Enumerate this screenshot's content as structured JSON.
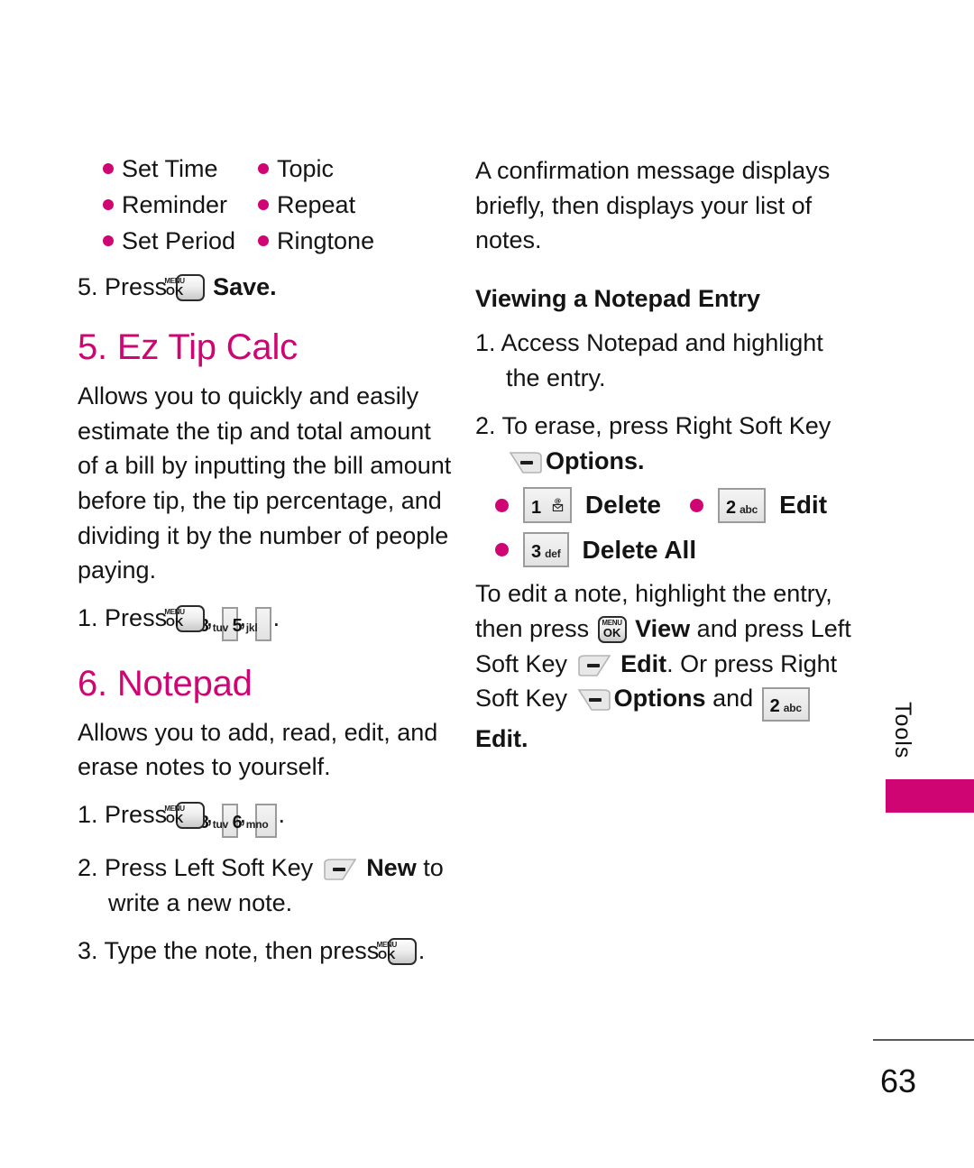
{
  "page": {
    "number": "63",
    "side_tab_label": "Tools",
    "accent_color": "#cf0573",
    "text_color": "#141414"
  },
  "left_column": {
    "feature_list": {
      "items": [
        {
          "col1": "Set Time",
          "col2": "Topic"
        },
        {
          "col1": "Reminder",
          "col2": "Repeat"
        },
        {
          "col1": "Set Period",
          "col2": "Ringtone"
        }
      ]
    },
    "step_save": {
      "number": "5.",
      "before_key": "Press",
      "key": "menu-ok",
      "after_key": "Save."
    },
    "section_ez_tip": {
      "heading": "5. Ez Tip Calc",
      "body": "Allows you to quickly and easily estimate the tip and total amount of a bill by inputting the bill amount before tip, the tip percentage, and dividing it by the number of people paying.",
      "step": {
        "number": "1.",
        "before_key": "Press",
        "keys": [
          {
            "type": "menu-ok"
          },
          {
            "type": "number",
            "digit": "8",
            "letters": "tuv"
          },
          {
            "type": "number",
            "digit": "5",
            "letters": "jkl"
          }
        ],
        "trailing": "."
      }
    },
    "section_notepad": {
      "heading": "6. Notepad",
      "body": "Allows you to add, read, edit, and erase notes to yourself.",
      "steps": [
        {
          "number": "1.",
          "before_key": "Press",
          "keys": [
            {
              "type": "menu-ok"
            },
            {
              "type": "number",
              "digit": "8",
              "letters": "tuv"
            },
            {
              "type": "number",
              "digit": "6",
              "letters": "mno"
            }
          ],
          "trailing": "."
        },
        {
          "number": "2.",
          "before_key": "Press Left Soft Key",
          "key": "left-soft-key",
          "bold_label": "New",
          "after": "to write a new note."
        },
        {
          "number": "3.",
          "before_key": "Type the note, then press",
          "key": "menu-ok",
          "trailing": "."
        }
      ]
    }
  },
  "right_column": {
    "intro": "A confirmation message displays briefly, then displays your list of notes.",
    "sub_heading": "Viewing a Notepad Entry",
    "step1": {
      "number": "1.",
      "text": "Access Notepad and highlight the entry."
    },
    "step2": {
      "number": "2.",
      "before_key": "To erase, press Right Soft Key",
      "key": "right-soft-key",
      "bold_label": "Options."
    },
    "options": [
      {
        "key": {
          "type": "number",
          "digit": "1",
          "letters": "envelope"
        },
        "label": "Delete"
      },
      {
        "key": {
          "type": "number",
          "digit": "2",
          "letters": "abc"
        },
        "label": "Edit"
      },
      {
        "key": {
          "type": "number",
          "digit": "3",
          "letters": "def"
        },
        "label": "Delete All"
      }
    ],
    "edit_note": {
      "t1": "To edit a note, highlight the",
      "t2": "entry, then press",
      "bold1": "View",
      "t3": "and press Left Soft Key",
      "bold2": "Edit",
      "t4": ". Or press Right Soft Key",
      "bold3": "Options",
      "t5": "and",
      "bold4": "Edit."
    }
  }
}
